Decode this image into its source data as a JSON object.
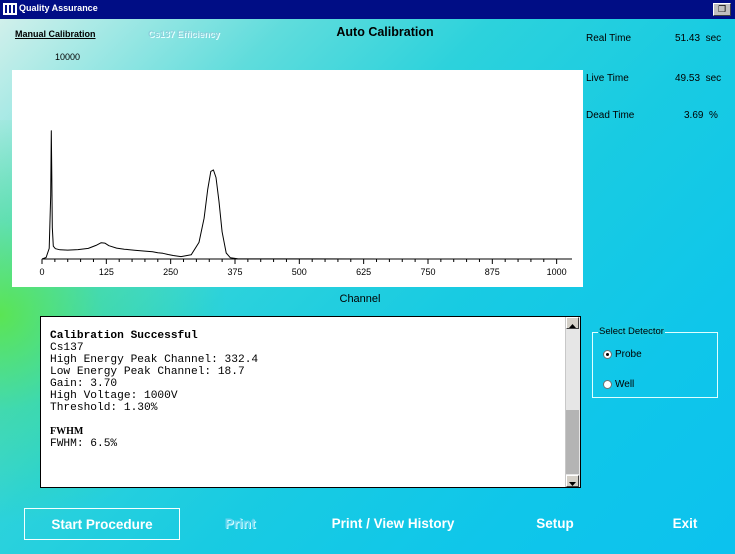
{
  "window": {
    "title": "Quality Assurance",
    "restore_icon": "restore-icon"
  },
  "tabs": {
    "manual": "Manual Calibration",
    "cs137": "Cs137 Efficiency"
  },
  "header": {
    "title": "Auto Calibration"
  },
  "plot": {
    "y_max_label": "10000",
    "x_axis_label": "Channel"
  },
  "stats": {
    "real_time": {
      "label": "Real Time",
      "value": "51.43",
      "unit": "sec"
    },
    "live_time": {
      "label": "Live Time",
      "value": "49.53",
      "unit": "sec"
    },
    "dead_time": {
      "label": "Dead Time",
      "value": "3.69",
      "unit": "%"
    }
  },
  "results": {
    "heading": "Calibration Successful",
    "isotope": "Cs137",
    "high_peak": "High Energy Peak Channel: 332.4",
    "low_peak": "Low Energy Peak Channel: 18.7",
    "gain": "Gain: 3.70",
    "high_voltage": "High Voltage: 1000V",
    "threshold": "Threshold: 1.30%",
    "fwhm_title": "FWHM",
    "fwhm": "FWHM: 6.5%"
  },
  "detector": {
    "legend": "Select Detector",
    "options": [
      {
        "label": "Probe",
        "selected": true
      },
      {
        "label": "Well",
        "selected": false
      }
    ]
  },
  "buttons": {
    "start": "Start Procedure",
    "print": "Print",
    "history": "Print / View History",
    "setup": "Setup",
    "exit": "Exit"
  },
  "chart_data": {
    "type": "line",
    "xlabel": "Channel",
    "xlim": [
      0,
      1024
    ],
    "x_ticks": [
      "0",
      "125",
      "250",
      "375",
      "500",
      "625",
      "750",
      "875",
      "1000"
    ],
    "series": [
      {
        "x": [
          0,
          8,
          14,
          17,
          18,
          19,
          20,
          22,
          26,
          35,
          50,
          70,
          90,
          105,
          115,
          122,
          130,
          145,
          160,
          180,
          200,
          215,
          225,
          235,
          245,
          255,
          270,
          290,
          305,
          315,
          322,
          328,
          333,
          338,
          344,
          350,
          358,
          366,
          380,
          420,
          520,
          700,
          880,
          1024
        ],
        "y": [
          0,
          100,
          700,
          4200,
          8500,
          5500,
          2100,
          850,
          680,
          610,
          590,
          620,
          700,
          900,
          1080,
          1050,
          880,
          720,
          650,
          580,
          520,
          480,
          420,
          380,
          300,
          230,
          160,
          280,
          1100,
          2700,
          4600,
          5800,
          5900,
          5400,
          3800,
          1800,
          400,
          80,
          20,
          8,
          4,
          2,
          1,
          0
        ]
      }
    ]
  }
}
